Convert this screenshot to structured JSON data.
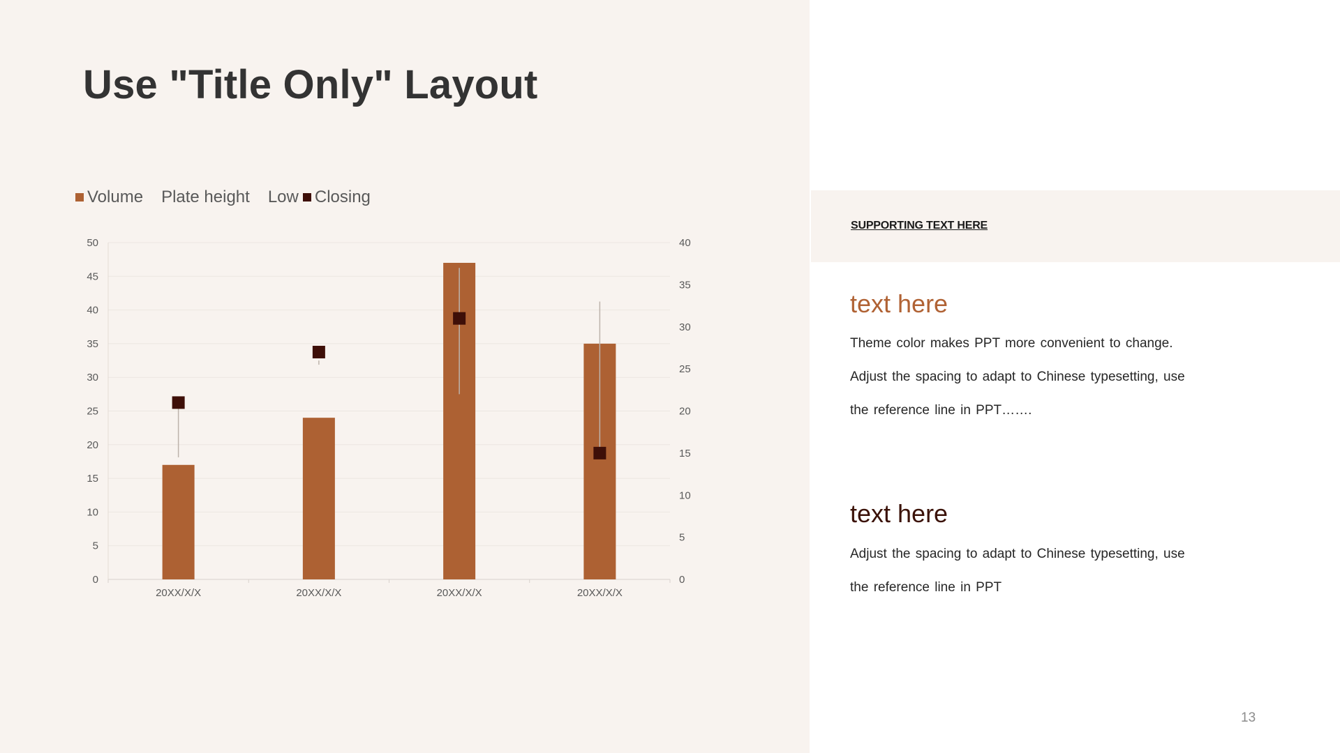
{
  "slide": {
    "title": "Use \"Title Only\" Layout",
    "page_number": "13"
  },
  "legend": {
    "items": [
      {
        "label": "Volume",
        "marker": "square",
        "color": "#ad6133"
      },
      {
        "label": "Plate height",
        "marker": "none"
      },
      {
        "label": "Low",
        "marker": "none"
      },
      {
        "label": "Closing",
        "marker": "square",
        "color": "#3e0f08"
      }
    ]
  },
  "chart_data": {
    "type": "bar",
    "title": "",
    "xlabel": "",
    "ylabel": "",
    "categories": [
      "20XX/X/X",
      "20XX/X/X",
      "20XX/X/X",
      "20XX/X/X"
    ],
    "primary_axis": {
      "min": 0,
      "max": 50,
      "step": 5,
      "ticks": [
        "0",
        "5",
        "10",
        "15",
        "20",
        "25",
        "30",
        "35",
        "40",
        "45",
        "50"
      ]
    },
    "secondary_axis": {
      "min": 0,
      "max": 40,
      "step": 5,
      "ticks": [
        "0",
        "5",
        "10",
        "15",
        "20",
        "25",
        "30",
        "35",
        "40"
      ]
    },
    "grid": true,
    "legend_position": "top-left",
    "series": [
      {
        "name": "Volume",
        "kind": "bar",
        "axis": "primary",
        "color": "#ad6133",
        "values": [
          17,
          24,
          47,
          35
        ]
      },
      {
        "name": "Plate height",
        "kind": "stock-high",
        "axis": "secondary",
        "values": [
          20.5,
          26,
          37,
          33
        ]
      },
      {
        "name": "Low",
        "kind": "stock-low",
        "axis": "secondary",
        "values": [
          14.5,
          25.5,
          22,
          15
        ]
      },
      {
        "name": "Closing",
        "kind": "marker",
        "axis": "secondary",
        "color": "#3e0f08",
        "values": [
          21,
          27,
          31,
          15
        ]
      }
    ]
  },
  "sidebar": {
    "supporting_label": "SUPPORTING TEXT HERE",
    "sections": [
      {
        "heading": "text here",
        "lines": [
          "Theme color makes PPT more convenient to change.",
          "Adjust the spacing to adapt to Chinese typesetting, use",
          "the reference line in PPT……."
        ]
      },
      {
        "heading": "text here",
        "lines": [
          "Adjust the spacing to adapt to Chinese typesetting, use",
          "the reference line in PPT"
        ]
      }
    ]
  }
}
